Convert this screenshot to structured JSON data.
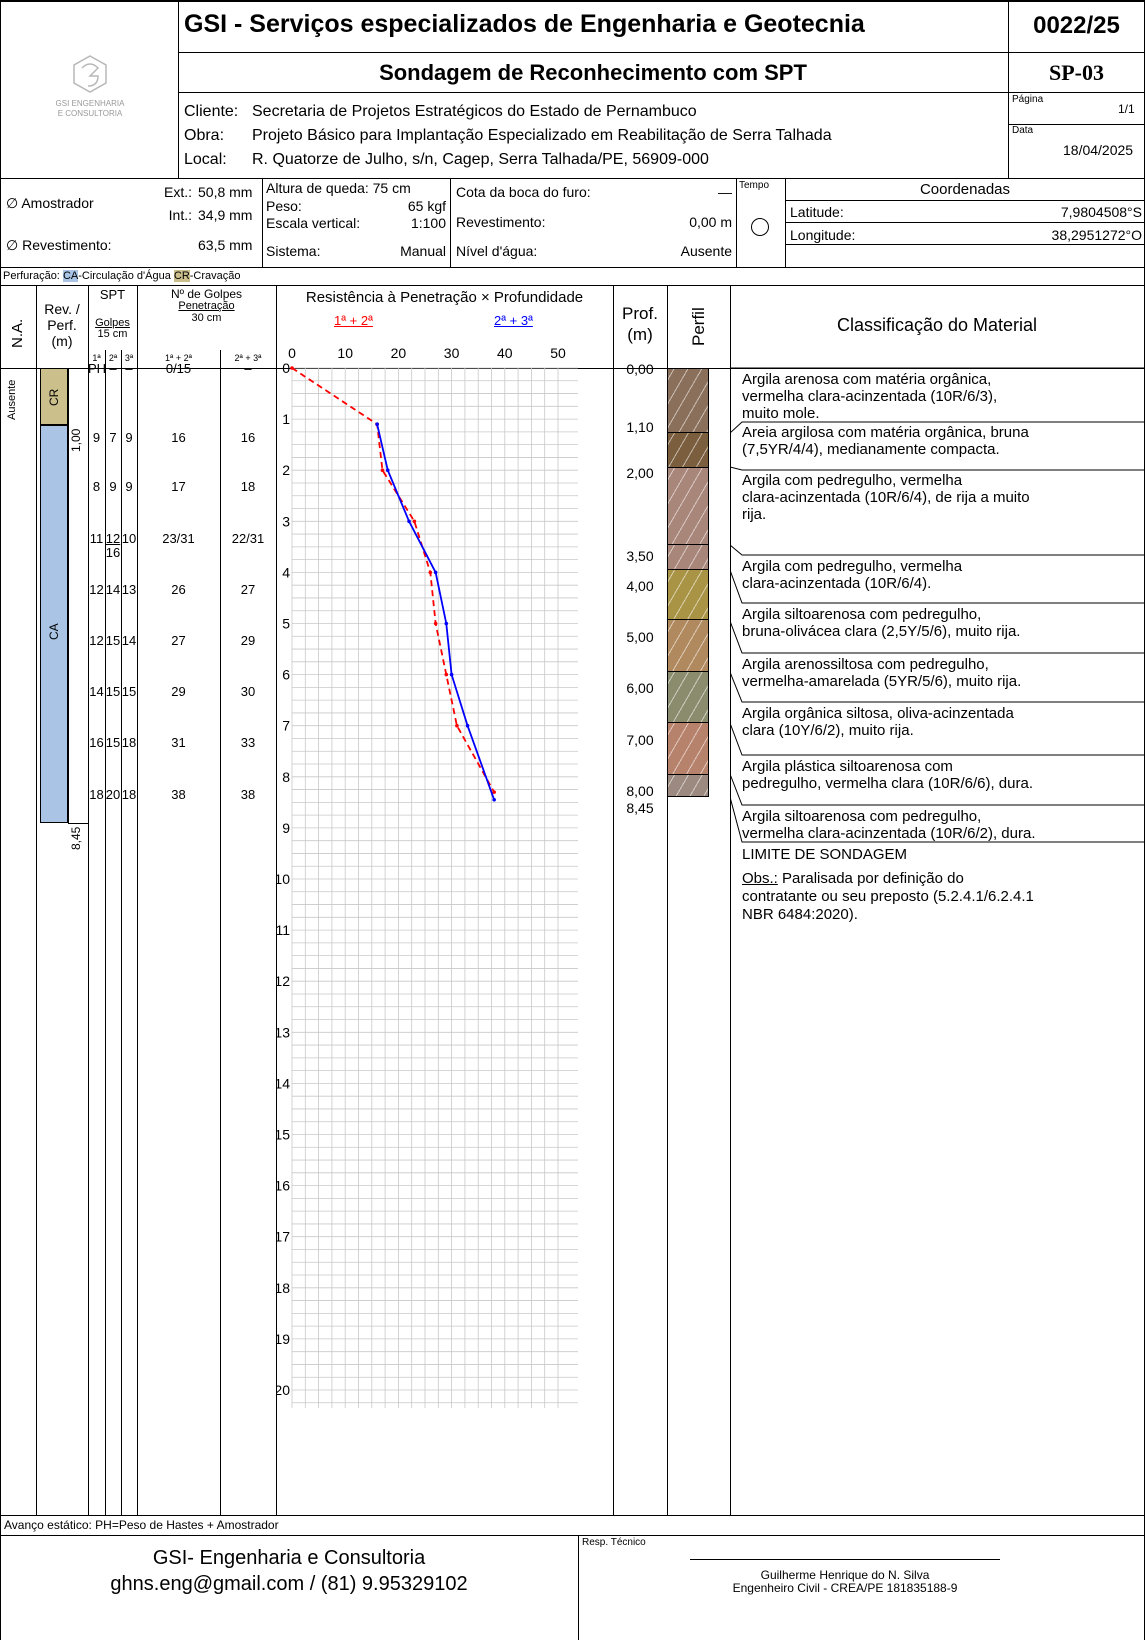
{
  "header": {
    "company_title": "GSI - Serviços especializados de Engenharia e Geotecnia",
    "report_number": "0022/25",
    "subtitle": "Sondagem de Reconhecimento com SPT",
    "borehole_id": "SP-03",
    "logo_line1": "GSI ENGENHARIA",
    "logo_line2": "E CONSULTORIA",
    "client_label": "Cliente:",
    "client_value": "Secretaria de Projetos Estratégicos do Estado de Pernambuco",
    "work_label": "Obra:",
    "work_value": "Projeto Básico para Implantação Especializado em Reabilitação de Serra Talhada",
    "location_label": "Local:",
    "location_value": "R. Quatorze de Julho, s/n, Cagep, Serra Talhada/PE, 56909-000",
    "page_label": "Página",
    "page_value": "1/1",
    "date_label": "Data",
    "date_value": "18/04/2025"
  },
  "params": {
    "sampler_label": "∅ Amostrador",
    "ext_label": "Ext.:",
    "ext_value": "50,8 mm",
    "int_label": "Int.:",
    "int_value": "34,9 mm",
    "casing_label": "∅ Revestimento:",
    "casing_value": "63,5 mm",
    "drop_label": "Altura de queda: 75 cm",
    "weight_label": "Peso:",
    "weight_value": "65 kgf",
    "scale_label": "Escala vertical:",
    "scale_value": "1:100",
    "system_label": "Sistema:",
    "system_value": "Manual",
    "mouth_label": "Cota da boca do furo:",
    "mouth_value": "—",
    "rev_label": "Revestimento:",
    "rev_value": "0,00 m",
    "water_label": "Nível d'água:",
    "water_value": "Ausente",
    "time_label": "Tempo",
    "coords_label": "Coordenadas",
    "lat_label": "Latitude:",
    "lat_value": "7,9804508°S",
    "lon_label": "Longitude:",
    "lon_value": "38,2951272°O"
  },
  "legend": {
    "prefix": "Perfuração:",
    "ca": "CA",
    "ca_text": "-Circulação d'Água",
    "cr": "CR",
    "cr_text": "-Cravação"
  },
  "columns": {
    "na": "N.A.",
    "rev_perf": "Rev. / Perf. (m)",
    "rev1": "Rev. /",
    "rev2": "Perf.",
    "rev3": "(m)",
    "spt": "SPT",
    "golpes": "Golpes",
    "cm15": "15 cm",
    "s1": "1ª",
    "s2": "2ª",
    "s3": "3ª",
    "ngolpes": "Nº de Golpes",
    "penetracao": "Penetração",
    "cm30": "30 cm",
    "p12": "1ª + 2ª",
    "p23": "2ª + 3ª",
    "resistance": "Resistência à Penetração × Profundidade",
    "leg12": "1ª + 2ª",
    "leg23": "2ª + 3ª",
    "prof": "Prof.",
    "prof_unit": "(m)",
    "perfil": "Perfil",
    "classification": "Classificação do Material"
  },
  "left_column": {
    "water": "Ausente",
    "cr": "CR",
    "ca": "CA",
    "rev_depth": "1,00",
    "perf_depth": "8,45"
  },
  "spt_rows": [
    {
      "g1": "PH",
      "g2": "–",
      "g3": "–",
      "p12": "0/15",
      "p23": "–"
    },
    {
      "g1": "9",
      "g2": "7",
      "g3": "9",
      "p12": "16",
      "p23": "16"
    },
    {
      "g1": "8",
      "g2": "9",
      "g3": "9",
      "p12": "17",
      "p23": "18"
    },
    {
      "g1": "11",
      "g2": "12",
      "g2b": "16",
      "g3": "10",
      "p12": "23/31",
      "p23": "22/31"
    },
    {
      "g1": "12",
      "g2": "14",
      "g3": "13",
      "p12": "26",
      "p23": "27"
    },
    {
      "g1": "12",
      "g2": "15",
      "g3": "14",
      "p12": "27",
      "p23": "29"
    },
    {
      "g1": "14",
      "g2": "15",
      "g3": "15",
      "p12": "29",
      "p23": "30"
    },
    {
      "g1": "16",
      "g2": "15",
      "g3": "18",
      "p12": "31",
      "p23": "33"
    },
    {
      "g1": "18",
      "g2": "20",
      "g3": "18",
      "p12": "38",
      "p23": "38"
    }
  ],
  "chart_data": {
    "type": "line",
    "title": "Resistência à Penetração × Profundidade",
    "x_ticks": [
      0,
      10,
      20,
      30,
      40,
      50
    ],
    "y_ticks": [
      0,
      1,
      2,
      3,
      4,
      5,
      6,
      7,
      8,
      9,
      10,
      11,
      12,
      13,
      14,
      15,
      16,
      17,
      18,
      19,
      20
    ],
    "xlim": [
      0,
      50
    ],
    "ylim": [
      0,
      20
    ],
    "y_inverted": true,
    "grid": true,
    "series": [
      {
        "name": "1ª + 2ª",
        "color": "#ff0000",
        "style": "dashed",
        "x": [
          0,
          16,
          17,
          23,
          26,
          27,
          29,
          31,
          38
        ],
        "y": [
          0,
          1.1,
          2,
          3,
          4,
          5,
          6,
          7,
          8.3
        ]
      },
      {
        "name": "2ª + 3ª",
        "color": "#0000ff",
        "style": "solid",
        "x": [
          16,
          18,
          22,
          27,
          29,
          30,
          33,
          38
        ],
        "y": [
          1.1,
          2,
          3,
          4,
          5,
          6,
          7,
          8.45
        ]
      }
    ]
  },
  "depths": [
    "0,00",
    "1,10",
    "2,00",
    "3,50",
    "4,00",
    "5,00",
    "6,00",
    "7,00",
    "8,00",
    "8,45"
  ],
  "layers": [
    {
      "color": "#8a6f5a",
      "text": [
        "Argila arenosa com matéria orgânica,",
        "vermelha clara-acinzentada (10R/6/3),",
        "muito mole."
      ]
    },
    {
      "color": "#7a5e3e",
      "text": [
        "Areia argilosa com matéria orgânica, bruna",
        "(7,5YR/4/4), medianamente compacta."
      ]
    },
    {
      "color": "#a8867a",
      "text": [
        "Argila  com pedregulho, vermelha",
        "clara-acinzentada (10R/6/4), de rija a muito",
        "rija."
      ]
    },
    {
      "color": "#a8867a",
      "text": [
        "Argila  com pedregulho, vermelha",
        "clara-acinzentada (10R/6/4)."
      ]
    },
    {
      "color": "#a99445",
      "text": [
        "Argila siltoarenosa com pedregulho,",
        "bruna-olivácea clara (2,5Y/5/6), muito rija."
      ]
    },
    {
      "color": "#b08a5e",
      "text": [
        "Argila arenossiltosa com pedregulho,",
        "vermelha-amarelada (5YR/5/6), muito rija."
      ]
    },
    {
      "color": "#8b8c6e",
      "text": [
        "Argila orgânica siltosa, oliva-acinzentada",
        "clara (10Y/6/2), muito rija."
      ]
    },
    {
      "color": "#b7826c",
      "text": [
        "Argila plástica siltoarenosa com",
        "pedregulho, vermelha clara (10R/6/6), dura."
      ]
    },
    {
      "color": "#9c8a80",
      "text": [
        "Argila siltoarenosa com pedregulho,",
        "vermelha clara-acinzentada (10R/6/2), dura."
      ]
    }
  ],
  "end_note": {
    "limit": "LIMITE DE SONDAGEM",
    "obs_label": "Obs.:",
    "obs_line1": " Paralisada por definição do",
    "obs_line2": "contratante ou seu preposto (5.2.4.1/6.2.4.1",
    "obs_line3": "NBR 6484:2020)."
  },
  "footer": {
    "advance": "Avanço estático: PH=Peso de Hastes + Amostrador",
    "company": "GSI- Engenharia e Consultoria",
    "contact": "ghns.eng@gmail.com / (81) 9.95329102",
    "resp_label": "Resp. Técnico",
    "engineer_name": "Guilherme Henrique do N. Silva",
    "engineer_title": "Engenheiro Civil - CREA/PE 181835188-9"
  }
}
